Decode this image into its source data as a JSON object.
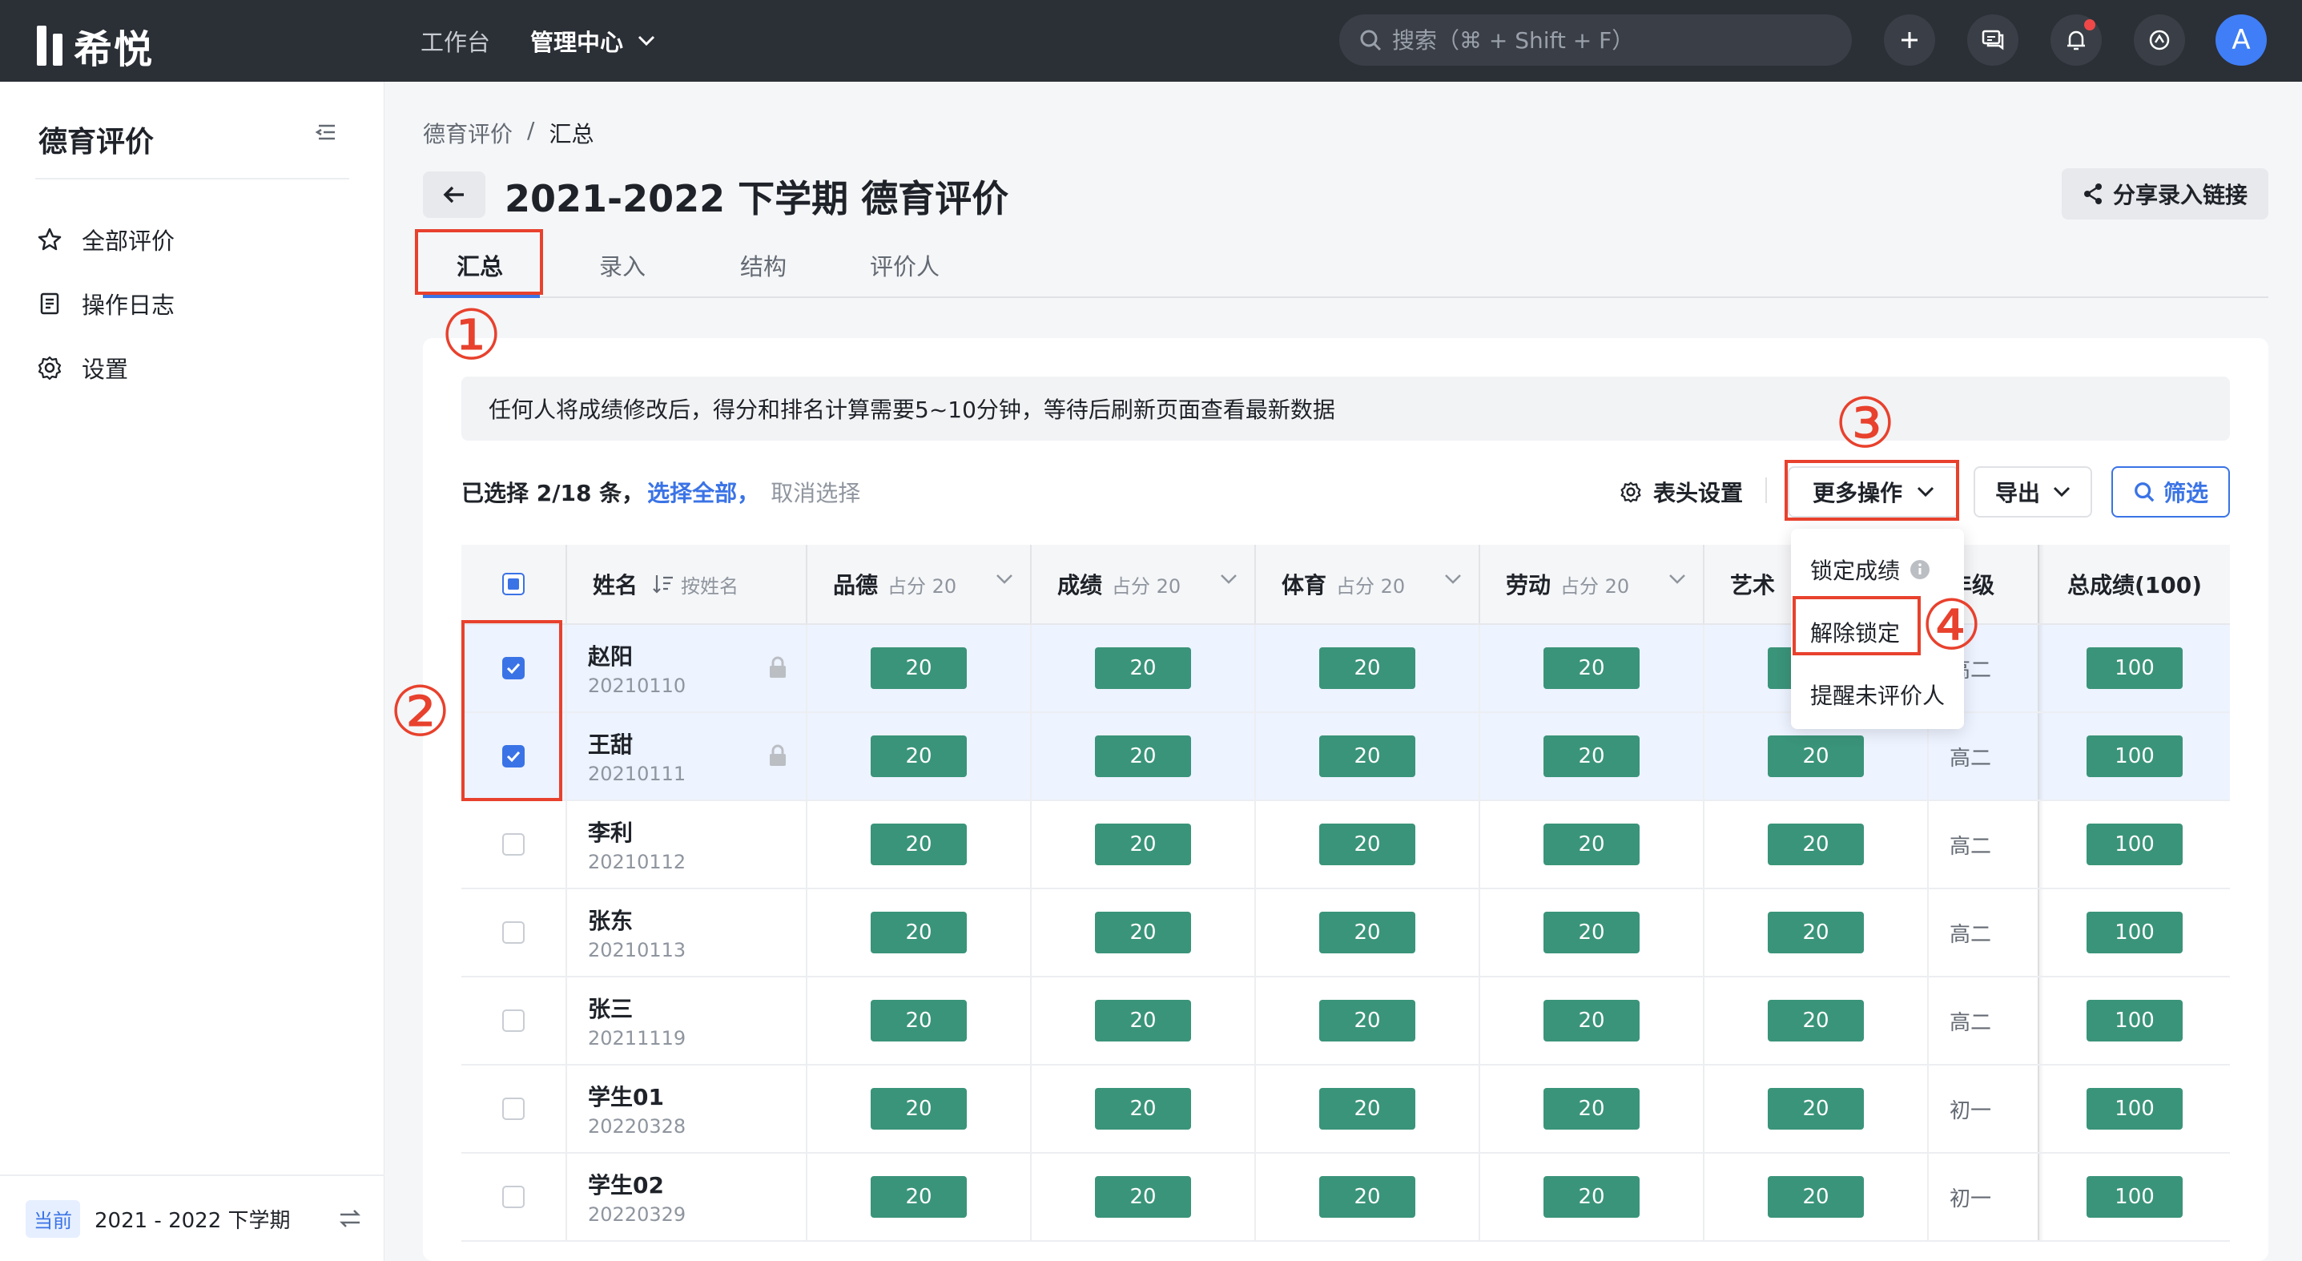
{
  "topbar": {
    "brand": "希悦",
    "nav": {
      "workbench": "工作台",
      "admin": "管理中心"
    },
    "search_placeholder": "搜索（⌘ + Shift + F）",
    "avatar_letter": "A"
  },
  "sidebar": {
    "title": "德育评价",
    "items": [
      {
        "label": "全部评价",
        "icon": "star-icon"
      },
      {
        "label": "操作日志",
        "icon": "document-icon"
      },
      {
        "label": "设置",
        "icon": "gear-icon"
      }
    ],
    "footer": {
      "badge": "当前",
      "term": "2021 - 2022 下学期"
    }
  },
  "main": {
    "breadcrumb": [
      "德育评价",
      "/",
      "汇总"
    ],
    "title": "2021-2022 下学期 德育评价",
    "share_label": "分享录入链接",
    "tabs": [
      "汇总",
      "录入",
      "结构",
      "评价人"
    ],
    "notice": "任何人将成绩修改后，得分和排名计算需要5~10分钟，等待后刷新页面查看最新数据",
    "selection": {
      "prefix": "已选择 2/18 条，",
      "select_all": "选择全部，",
      "cancel": "取消选择"
    },
    "toolbar": {
      "header_settings": "表头设置",
      "more_actions": "更多操作",
      "export": "导出",
      "filter": "筛选"
    },
    "dropdown": [
      "锁定成绩",
      "解除锁定",
      "提醒未评价人"
    ],
    "table": {
      "headers": {
        "name": "姓名",
        "sort": "按姓名",
        "cols": [
          {
            "label": "品德",
            "sub": "占分 20"
          },
          {
            "label": "成绩",
            "sub": "占分 20"
          },
          {
            "label": "体育",
            "sub": "占分 20"
          },
          {
            "label": "劳动",
            "sub": "占分 20"
          },
          {
            "label": "艺术",
            "sub": ""
          }
        ],
        "grade": "年级",
        "total": "总成绩(100)"
      },
      "rows": [
        {
          "name": "赵阳",
          "id": "20210110",
          "checked": true,
          "locked": true,
          "scores": [
            "20",
            "20",
            "20",
            "20",
            "20"
          ],
          "grade": "高二",
          "total": "100"
        },
        {
          "name": "王甜",
          "id": "20210111",
          "checked": true,
          "locked": true,
          "scores": [
            "20",
            "20",
            "20",
            "20",
            "20"
          ],
          "grade": "高二",
          "total": "100"
        },
        {
          "name": "李利",
          "id": "20210112",
          "checked": false,
          "locked": false,
          "scores": [
            "20",
            "20",
            "20",
            "20",
            "20"
          ],
          "grade": "高二",
          "total": "100"
        },
        {
          "name": "张东",
          "id": "20210113",
          "checked": false,
          "locked": false,
          "scores": [
            "20",
            "20",
            "20",
            "20",
            "20"
          ],
          "grade": "高二",
          "total": "100"
        },
        {
          "name": "张三",
          "id": "20211119",
          "checked": false,
          "locked": false,
          "scores": [
            "20",
            "20",
            "20",
            "20",
            "20"
          ],
          "grade": "高二",
          "total": "100"
        },
        {
          "name": "学生01",
          "id": "20220328",
          "checked": false,
          "locked": false,
          "scores": [
            "20",
            "20",
            "20",
            "20",
            "20"
          ],
          "grade": "初一",
          "total": "100"
        },
        {
          "name": "学生02",
          "id": "20220329",
          "checked": false,
          "locked": false,
          "scores": [
            "20",
            "20",
            "20",
            "20",
            "20"
          ],
          "grade": "初一",
          "total": "100"
        }
      ]
    }
  },
  "annotations": [
    "①",
    "②",
    "③",
    "④"
  ],
  "colors": {
    "accent": "#3a73e6",
    "score_bg": "#3a9479",
    "annotation": "#e8412d",
    "topbar": "#2b2f36"
  }
}
